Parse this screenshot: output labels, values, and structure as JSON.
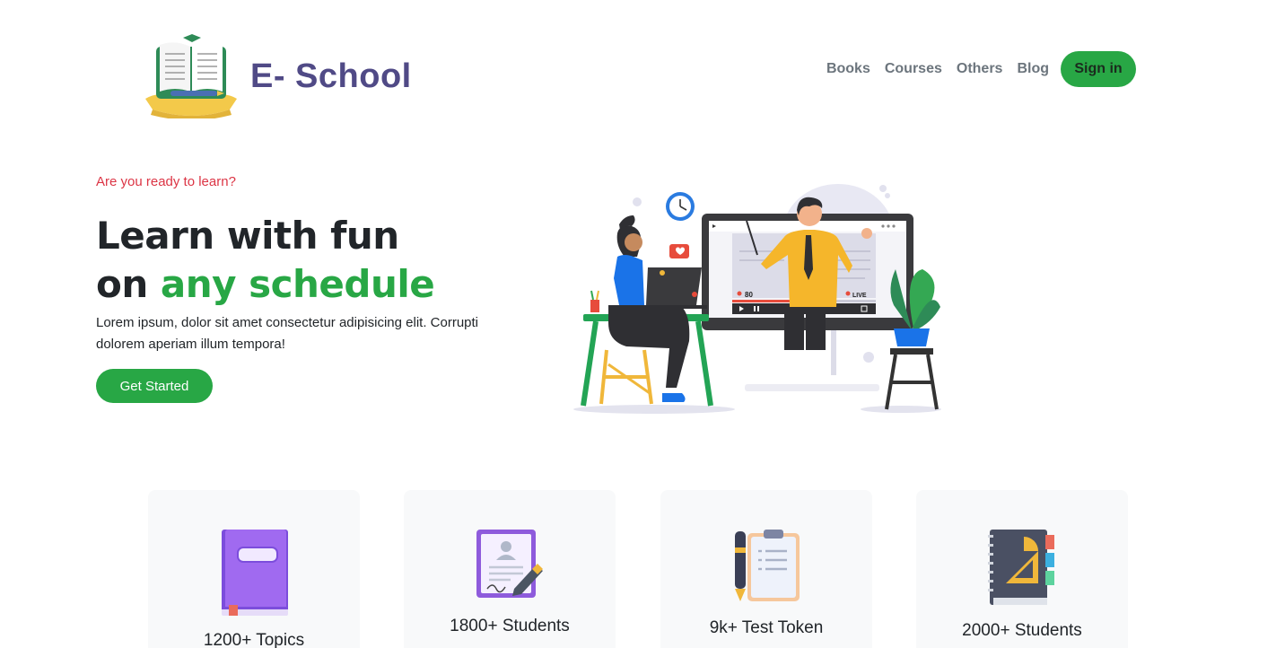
{
  "brand": {
    "name": "E- School"
  },
  "nav": {
    "items": [
      {
        "label": "Books"
      },
      {
        "label": "Courses"
      },
      {
        "label": "Others"
      },
      {
        "label": "Blog"
      }
    ],
    "signin_label": "Sign in"
  },
  "hero": {
    "tagline": "Are you ready to learn?",
    "title_line1": "Learn with fun",
    "title_line2_prefix": "on",
    "title_line2_accent": "any schedule",
    "description": "Lorem ipsum, dolor sit amet consectetur adipisicing elit. Corrupti dolorem aperiam illum tempora!",
    "cta_label": "Get Started",
    "illustration": {
      "screen_viewers": "80",
      "screen_live": "LIVE"
    }
  },
  "stats": [
    {
      "label": "1200+ Topics",
      "icon": "book-icon"
    },
    {
      "label": "1800+ Students",
      "icon": "certificate-icon"
    },
    {
      "label": "9k+ Test Token",
      "icon": "clipboard-pen-icon"
    },
    {
      "label": "2000+ Students",
      "icon": "notebook-icon"
    }
  ],
  "colors": {
    "brand": "#504a86",
    "accent": "#28a745",
    "tagline": "#dc3545",
    "card_bg": "#f8f9fa"
  }
}
